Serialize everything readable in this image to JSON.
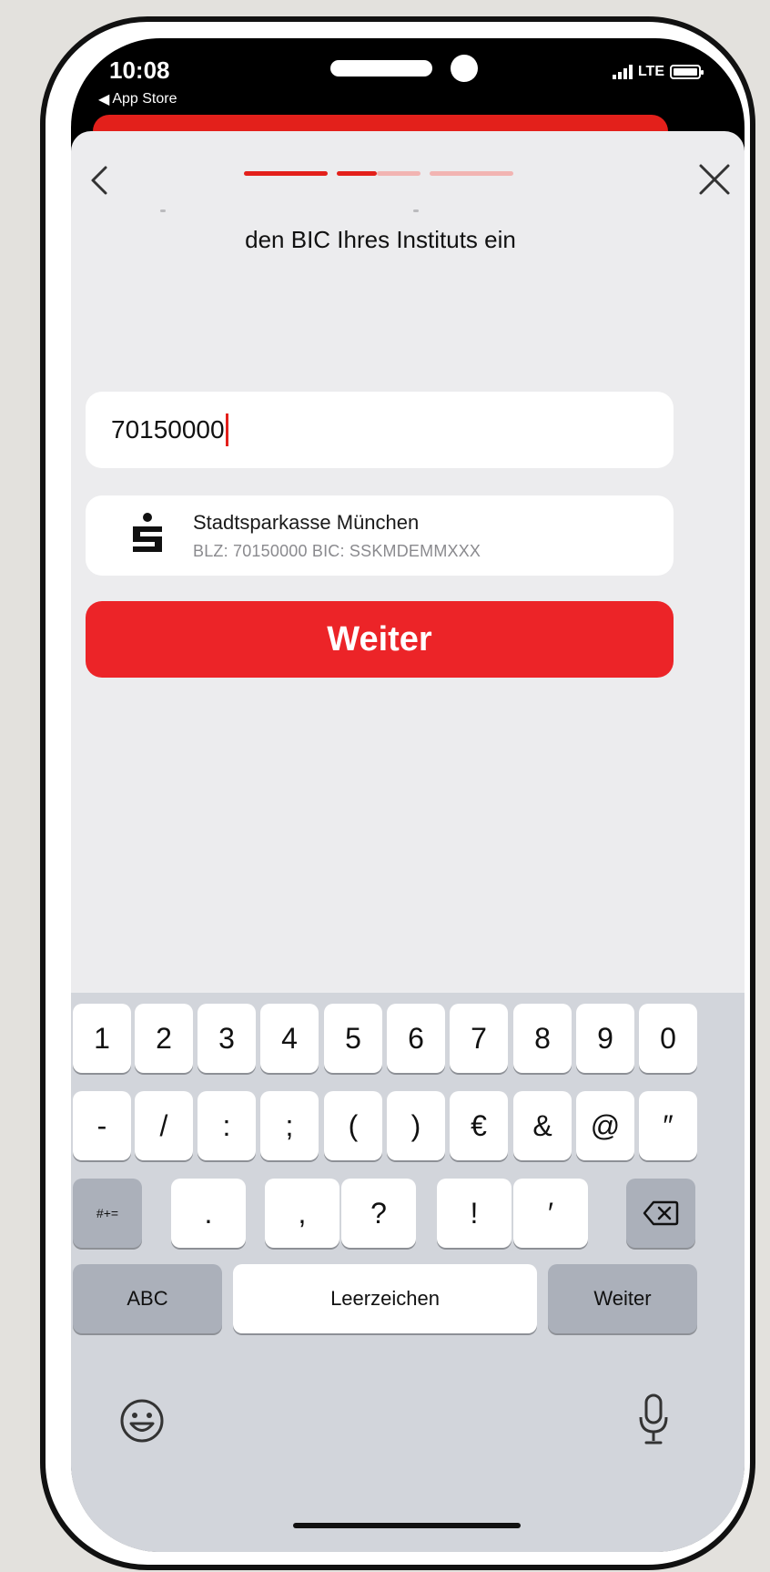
{
  "status_bar": {
    "time": "10:08",
    "back_app": "App Store",
    "network": "LTE"
  },
  "header": {
    "back_icon": "chevron-left-icon",
    "close_icon": "close-icon",
    "progress_colors": {
      "active": "#e3201b",
      "inactive": "#f2b4b2"
    }
  },
  "main": {
    "instruction_text": "den BIC Ihres Instituts ein",
    "blz_input": {
      "value": "70150000"
    },
    "bank_result": {
      "name": "Stadtsparkasse München",
      "codes": "BLZ: 70150000   BIC: SSKMDEMMXXX",
      "logo": "sparkasse-logo-icon"
    },
    "continue_button": "Weiter",
    "accent_color": "#ec2428"
  },
  "keyboard": {
    "row1": [
      "1",
      "2",
      "3",
      "4",
      "5",
      "6",
      "7",
      "8",
      "9",
      "0"
    ],
    "row2": [
      "-",
      "/",
      ":",
      ";",
      "(",
      ")",
      "€",
      "&",
      "@",
      "″"
    ],
    "row3_symbols_key": "#+=",
    "row3": [
      ".",
      ",",
      "?",
      "!",
      "′"
    ],
    "abc_key": "ABC",
    "space_key": "Leerzeichen",
    "return_key": "Weiter"
  }
}
